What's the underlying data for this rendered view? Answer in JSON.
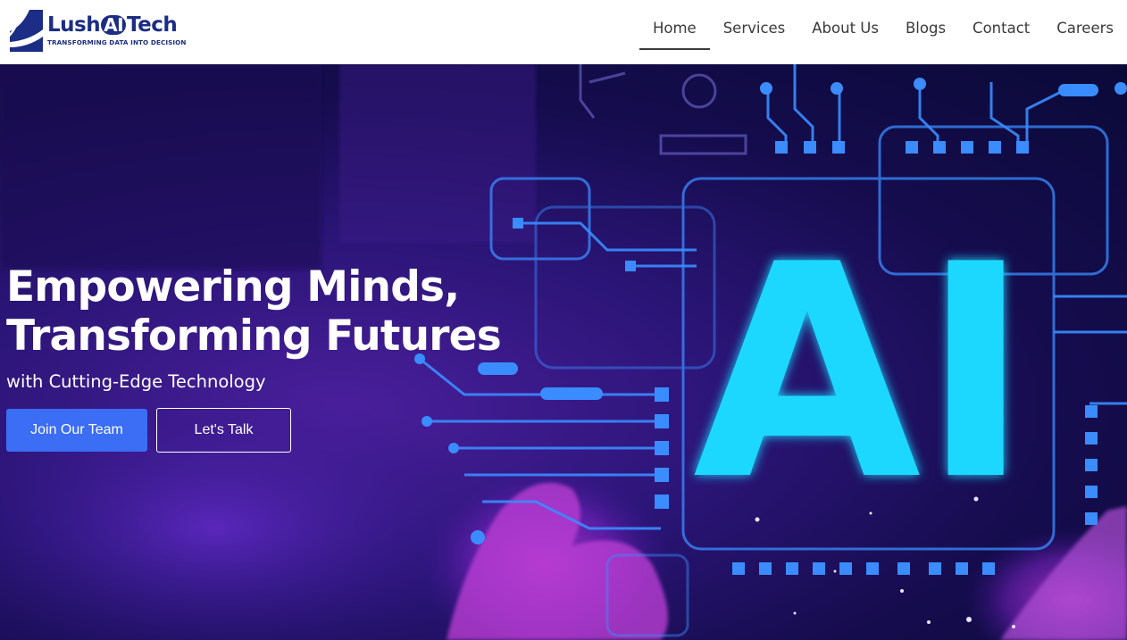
{
  "brand": {
    "name_pre": "Lush",
    "name_ai": "AI",
    "name_post": "Tech",
    "tagline": "TRANSFORMING DATA INTO DECISION",
    "color": "#1b2d84"
  },
  "nav": {
    "items": [
      {
        "label": "Home",
        "active": true
      },
      {
        "label": "Services",
        "active": false
      },
      {
        "label": "About Us",
        "active": false
      },
      {
        "label": "Blogs",
        "active": false
      },
      {
        "label": "Contact",
        "active": false
      },
      {
        "label": "Careers",
        "active": false
      }
    ]
  },
  "hero": {
    "title_line1": "Empowering Minds,",
    "title_line2": "Transforming Futures",
    "subtitle": "with Cutting-Edge Technology",
    "primary_button": "Join Our Team",
    "secondary_button": "Let's Talk",
    "graphic_text": "AI",
    "colors": {
      "primary_button": "#3b6df5",
      "ai_glow": "#1ed8ff",
      "circuit": "#3a8cff"
    }
  }
}
